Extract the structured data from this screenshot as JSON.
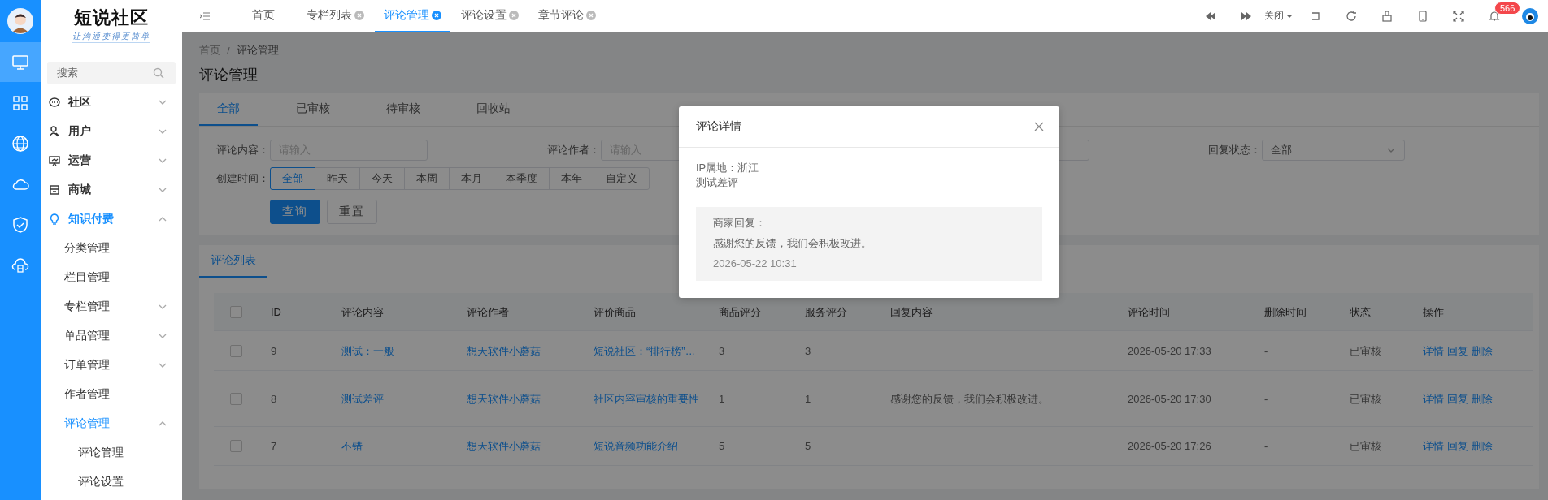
{
  "rail": {
    "items": [
      {
        "selected": true
      },
      {
        "selected": false
      },
      {
        "selected": false
      },
      {
        "selected": false
      },
      {
        "selected": false
      },
      {
        "selected": false
      }
    ]
  },
  "logo": {
    "title": "短说社区",
    "slogan": "让沟通变得更简单"
  },
  "sidebar": {
    "search_placeholder": "搜索",
    "items": [
      {
        "label": "社区",
        "kind": "group",
        "expanded": false,
        "selected": false
      },
      {
        "label": "用户",
        "kind": "group",
        "expanded": false,
        "selected": false
      },
      {
        "label": "运营",
        "kind": "group",
        "expanded": false,
        "selected": false
      },
      {
        "label": "商城",
        "kind": "group",
        "expanded": false,
        "selected": false
      },
      {
        "label": "知识付费",
        "kind": "group",
        "expanded": true,
        "selected": true,
        "children": [
          {
            "label": "分类管理",
            "selected": false
          },
          {
            "label": "栏目管理",
            "selected": false
          },
          {
            "label": "专栏管理",
            "kind": "group",
            "expanded": false,
            "selected": false
          },
          {
            "label": "单品管理",
            "kind": "group",
            "expanded": false,
            "selected": false
          },
          {
            "label": "订单管理",
            "kind": "group",
            "expanded": false,
            "selected": false
          },
          {
            "label": "作者管理",
            "selected": false
          },
          {
            "label": "评论管理",
            "kind": "group",
            "expanded": true,
            "selected": true,
            "children": [
              {
                "label": "评论管理",
                "selected": false
              },
              {
                "label": "评论设置",
                "selected": false
              }
            ]
          }
        ]
      }
    ]
  },
  "tabs": [
    {
      "label": "首页",
      "selected": false,
      "closable": false
    },
    {
      "label": "专栏列表",
      "selected": false,
      "closable": true
    },
    {
      "label": "评论管理",
      "selected": true,
      "closable": true
    },
    {
      "label": "评论设置",
      "selected": false,
      "closable": true
    },
    {
      "label": "章节评论",
      "selected": false,
      "closable": true
    }
  ],
  "toolbar": {
    "close_menu": "关闭",
    "notification_count": "566"
  },
  "breadcrumb": {
    "items": [
      "首页",
      "评论管理"
    ],
    "separator": "/"
  },
  "page_title": "评论管理",
  "filter_tabs": [
    {
      "label": "全部",
      "selected": true
    },
    {
      "label": "已审核",
      "selected": false
    },
    {
      "label": "待审核",
      "selected": false
    },
    {
      "label": "回收站",
      "selected": false
    }
  ],
  "filters": [
    {
      "kind": "text",
      "label": "评论内容：",
      "placeholder": "请输入"
    },
    {
      "kind": "text",
      "label": "评论作者：",
      "placeholder": "请输入"
    },
    {
      "kind": "text"
    },
    {
      "kind": "select",
      "label": "回复状态：",
      "value": "全部"
    }
  ],
  "date_filter": {
    "label": "创建时间：",
    "options": [
      {
        "label": "全部",
        "selected": true
      },
      {
        "label": "昨天",
        "selected": false
      },
      {
        "label": "今天",
        "selected": false
      },
      {
        "label": "本周",
        "selected": false
      },
      {
        "label": "本月",
        "selected": false
      },
      {
        "label": "本季度",
        "selected": false
      },
      {
        "label": "本年",
        "selected": false
      },
      {
        "label": "自定义",
        "selected": false
      }
    ]
  },
  "buttons": [
    {
      "label": "查询",
      "kind": "primary"
    },
    {
      "label": "重置",
      "kind": "default"
    }
  ],
  "list_tabs": [
    {
      "label": "评论列表",
      "selected": true
    }
  ],
  "table": {
    "header_checked": false,
    "columns": [
      "ID",
      "评论内容",
      "评论作者",
      "评价商品",
      "商品评分",
      "服务评分",
      "回复内容",
      "评论时间",
      "删除时间",
      "状态",
      "操作"
    ],
    "rows": [
      {
        "checked": false,
        "id": "9",
        "content": "测试：一般",
        "author": "想天软件小蘑菇",
        "product": "短说社区：“排行榜”…",
        "product_score": "3",
        "service_score": "3",
        "time": "2026-05-20 17:33",
        "deleted": "-",
        "status": "已审核",
        "actions": [
          "详情",
          "回复",
          "删除"
        ]
      },
      {
        "checked": false,
        "id": "8",
        "content": "测试差评",
        "author": "想天软件小蘑菇",
        "product": "社区内容审核的重要性",
        "product_score": "1",
        "service_score": "1",
        "reply": "感谢您的反馈，我们会积极改进。",
        "time": "2026-05-20 17:30",
        "deleted": "-",
        "status": "已审核",
        "actions": [
          "详情",
          "回复",
          "删除"
        ]
      },
      {
        "checked": false,
        "id": "7",
        "content": "不错",
        "author": "想天软件小蘑菇",
        "product": "短说音频功能介绍",
        "product_score": "5",
        "service_score": "5",
        "time": "2026-05-20 17:26",
        "deleted": "-",
        "status": "已审核",
        "actions": [
          "详情",
          "回复",
          "删除"
        ]
      }
    ]
  },
  "dialog": {
    "title": "评论详情",
    "ip": "IP属地：浙江",
    "content": "测试差评",
    "reply_label": "商家回复：",
    "reply": "感谢您的反馈，我们会积极改进。",
    "reply_time": "2026-05-22 10:31"
  }
}
